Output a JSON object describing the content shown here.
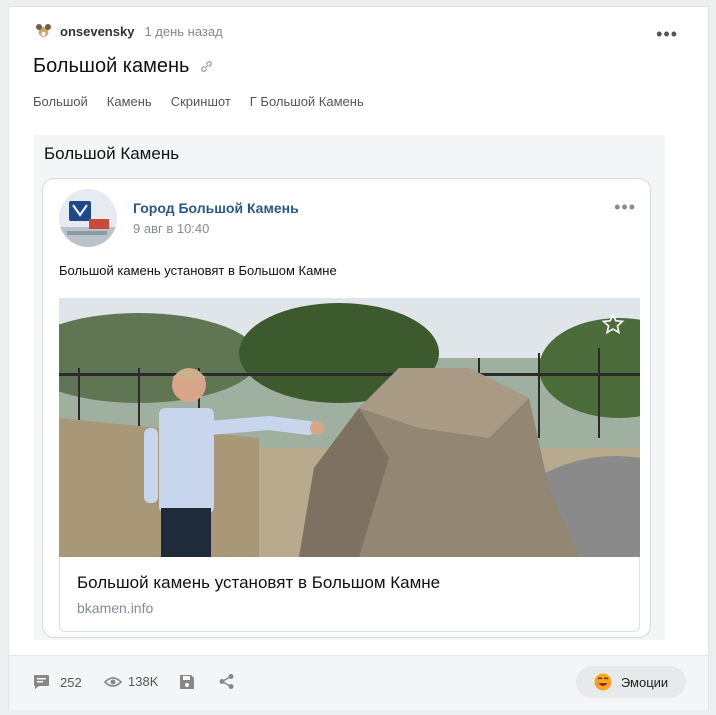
{
  "post": {
    "author": "onsevensky",
    "time": "1 день назад",
    "title": "Большой камень",
    "tags": [
      "Большой",
      "Камень",
      "Скриншот",
      "Г Большой Камень"
    ]
  },
  "content": {
    "heading": "Большой Камень",
    "embed": {
      "group_name": "Город Большой Камень",
      "date": "9 авг в 10:40",
      "text": "Большой камень установят в Большом Камне",
      "link_title": "Большой камень установят в Большом Камне",
      "link_domain": "bkamen.info"
    }
  },
  "footer": {
    "comments": "252",
    "views": "138K",
    "emotions_label": "Эмоции"
  },
  "icons": {
    "link": "link-icon",
    "more": "more-icon",
    "star": "star-icon",
    "comment": "comment-icon",
    "views": "eye-icon",
    "save": "save-icon",
    "share": "share-icon",
    "emotion": "emoji-icon"
  }
}
